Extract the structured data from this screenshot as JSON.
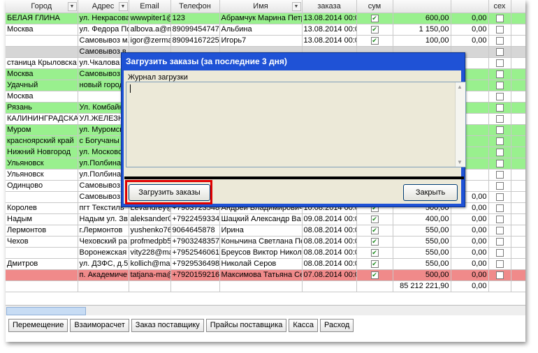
{
  "grid": {
    "columns": [
      "Город",
      "Адрес",
      "Email",
      "Телефон",
      "Имя",
      "заказа",
      "сум",
      "",
      "",
      "сех"
    ],
    "rows": [
      {
        "style": "green",
        "city": "БЕЛАЯ ГЛИНА",
        "address": "ул. Некрасова",
        "email": "wwwpiter1@",
        "phone": "123",
        "name": "Абрамчук Марина Петр",
        "date": "13.08.2014 00:0",
        "checked": true,
        "sum": "600,00",
        "extra": "0,00"
      },
      {
        "style": "",
        "city": "Москва",
        "address": "ул. Федора По",
        "email": "albova.a@m",
        "phone": "89099454747",
        "name": "Альбина",
        "date": "13.08.2014 00:0",
        "checked": true,
        "sum": "1 150,00",
        "extra": "0,00"
      },
      {
        "style": "",
        "city": "",
        "address": "Самовывоз м.",
        "email": "igor@zerma",
        "phone": "89094167225",
        "name": "Игорь7",
        "date": "13.08.2014 00:0",
        "checked": true,
        "sum": "100,00",
        "extra": "0,00"
      },
      {
        "style": "gray",
        "city": "",
        "address": "Самовывоз в",
        "email": "",
        "phone": "",
        "name": "",
        "date": "",
        "checked": false,
        "sum": "",
        "extra": ""
      },
      {
        "style": "",
        "city": "станица Крыловска",
        "address": "ул.Чкалова",
        "email": "",
        "phone": "",
        "name": "",
        "date": "",
        "checked": false,
        "sum": "",
        "extra": ""
      },
      {
        "style": "green",
        "city": "Москва",
        "address": "Самовывоз н",
        "email": "",
        "phone": "",
        "name": "",
        "date": "",
        "checked": false,
        "sum": "",
        "extra": ""
      },
      {
        "style": "green",
        "city": "Удачный",
        "address": "новый город",
        "email": "",
        "phone": "",
        "name": "",
        "date": "",
        "checked": false,
        "sum": "",
        "extra": ""
      },
      {
        "style": "",
        "city": "Москва",
        "address": "",
        "email": "",
        "phone": "",
        "name": "",
        "date": "",
        "checked": false,
        "sum": "",
        "extra": ""
      },
      {
        "style": "green",
        "city": "Рязань",
        "address": "Ул. Комбайн",
        "email": "",
        "phone": "",
        "name": "",
        "date": "",
        "checked": false,
        "sum": "",
        "extra": ""
      },
      {
        "style": "",
        "city": "КАЛИНИНГРАДСКА",
        "address": "УЛ.ЖЕЛЕЗН",
        "email": "",
        "phone": "",
        "name": "",
        "date": "",
        "checked": false,
        "sum": "",
        "extra": ""
      },
      {
        "style": "green",
        "city": "Муром",
        "address": "ул. Муромск",
        "email": "",
        "phone": "",
        "name": "",
        "date": "",
        "checked": false,
        "sum": "",
        "extra": ""
      },
      {
        "style": "green",
        "city": "красноярский край",
        "address": "с Богучаны",
        "email": "",
        "phone": "",
        "name": "",
        "date": "",
        "checked": false,
        "sum": "",
        "extra": ""
      },
      {
        "style": "green",
        "city": "Нижний Новгород",
        "address": "ул. Московс",
        "email": "",
        "phone": "",
        "name": "",
        "date": "",
        "checked": false,
        "sum": "",
        "extra": ""
      },
      {
        "style": "green",
        "city": "Ульяновск",
        "address": "ул.Полбина",
        "email": "",
        "phone": "",
        "name": "",
        "date": "",
        "checked": false,
        "sum": "",
        "extra": ""
      },
      {
        "style": "",
        "city": "Ульяновск",
        "address": "ул.Полбина",
        "email": "",
        "phone": "",
        "name": "",
        "date": "",
        "checked": false,
        "sum": "",
        "extra": ""
      },
      {
        "style": "",
        "city": "Одинцово",
        "address": "Самовывоз",
        "email": "",
        "phone": "",
        "name": "",
        "date": "",
        "checked": false,
        "sum": "",
        "extra": ""
      },
      {
        "style": "",
        "city": "",
        "address": "Самовывоз М",
        "email": "ekaterina.s",
        "phone": "89037541303",
        "name": "Екатерина",
        "date": "10.08.2014 00:0",
        "checked": true,
        "sum": "450,00",
        "extra": "0,00"
      },
      {
        "style": "",
        "city": "Королев",
        "address": "пгт Текстиль",
        "email": "Levandrey@",
        "phone": "+7903723548",
        "name": "Андрей Владимирович",
        "date": "10.08.2014 00:0",
        "checked": true,
        "sum": "500,00",
        "extra": "0,00"
      },
      {
        "style": "",
        "city": "Надым",
        "address": "Надым ул. Зв",
        "email": "aleksander0",
        "phone": "+7922459334",
        "name": "Шацкий Александр Ва",
        "date": "09.08.2014 00:0",
        "checked": true,
        "sum": "400,00",
        "extra": "0,00"
      },
      {
        "style": "",
        "city": "Лермонтов",
        "address": "г.Лермонтов",
        "email": "yushenko76",
        "phone": "9064645878",
        "name": "Ирина",
        "date": "08.08.2014 00:0",
        "checked": true,
        "sum": "550,00",
        "extra": "0,00"
      },
      {
        "style": "",
        "city": "Чехов",
        "address": "Чеховский ра",
        "email": "profmedpb5",
        "phone": "+7903248357",
        "name": "Конычина Светлана Пе",
        "date": "08.08.2014 00:0",
        "checked": true,
        "sum": "550,00",
        "extra": "0,00"
      },
      {
        "style": "",
        "city": "",
        "address": "Воронежская",
        "email": "vity228@ma",
        "phone": "+7952546061",
        "name": "Бреусов Виктор Никол",
        "date": "08.08.2014 00:0",
        "checked": true,
        "sum": "550,00",
        "extra": "0,00"
      },
      {
        "style": "",
        "city": "Дмитров",
        "address": "ул. ДЗФС, д.5",
        "email": "kollich@mail",
        "phone": "+7929536498",
        "name": "Николай Серов",
        "date": "08.08.2014 00:0",
        "checked": true,
        "sum": "550,00",
        "extra": "0,00"
      },
      {
        "style": "red",
        "city": "",
        "address": "п. Академиче",
        "email": "tatjana-ma@",
        "phone": "+7920159216",
        "name": "Максимова Татьяна Се",
        "date": "07.08.2014 00:0",
        "checked": true,
        "sum": "500,00",
        "extra": "0,00"
      }
    ],
    "total_sum": "85 212 221,90",
    "total_extra": "0,00"
  },
  "tabs": [
    "Перемещение",
    "Взаиморасчет",
    "Заказ поставщику",
    "Прайсы поставщика",
    "Касса",
    "Расход"
  ],
  "dialog": {
    "title": "Загрузить заказы (за последние 3 дня)",
    "log_label": "Журнал загрузки",
    "log_text": "",
    "load_button": "Загрузить заказы",
    "close_button": "Закрыть"
  }
}
